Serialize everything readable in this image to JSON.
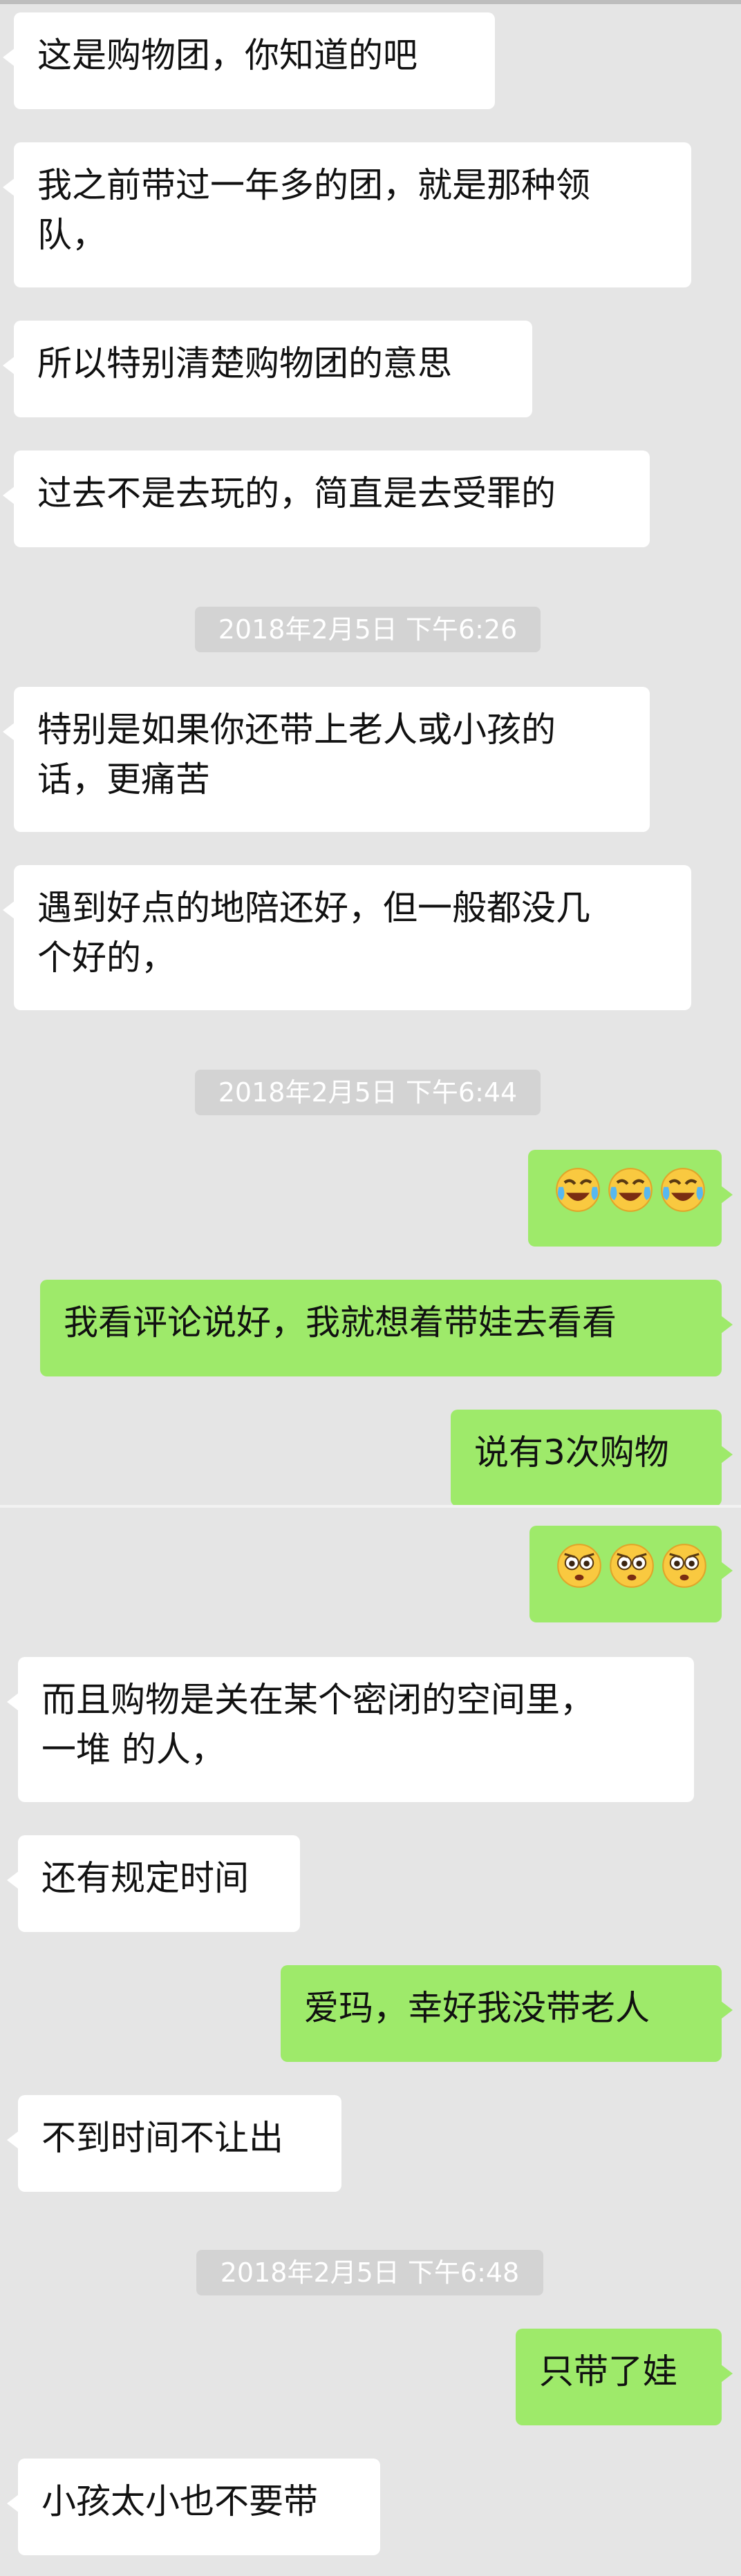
{
  "messages": [
    {
      "side": "in",
      "text": "这是购物团，你知道的吧"
    },
    {
      "side": "in",
      "text": "我之前带过一年多的团，就是那种领\n队，"
    },
    {
      "side": "in",
      "text": "所以特别清楚购物团的意思"
    },
    {
      "side": "in",
      "text": "过去不是去玩的，简直是去受罪的"
    },
    {
      "side": "in",
      "text": "特别是如果你还带上老人或小孩的\n话，更痛苦"
    },
    {
      "side": "in",
      "text": "遇到好点的地陪还好，但一般都没几\n个好的，"
    },
    {
      "side": "out",
      "emoji": "crying-laughing-face",
      "count": 3
    },
    {
      "side": "out",
      "text": "我看评论说好，我就想着带娃去看看"
    },
    {
      "side": "out",
      "text": "说有3次购物"
    },
    {
      "side": "out",
      "emoji": "wide-eyed-face",
      "count": 3
    },
    {
      "side": "in",
      "text": "而且购物是关在某个密闭的空间里，\n一堆 的人，"
    },
    {
      "side": "in",
      "text": "还有规定时间"
    },
    {
      "side": "out",
      "text": "爱玛，幸好我没带老人"
    },
    {
      "side": "in",
      "text": "不到时间不让出"
    },
    {
      "side": "out",
      "text": "只带了娃"
    },
    {
      "side": "in",
      "text": "小孩太小也不要带"
    }
  ],
  "timestamps": [
    "2018年2月5日 下午6:26",
    "2018年2月5日 下午6:44",
    "2018年2月5日 下午6:48"
  ],
  "colors": {
    "background": "#e5e5e5",
    "incoming_bubble": "#ffffff",
    "outgoing_bubble": "#9eea6a",
    "timestamp_badge": "#d3d3d3"
  }
}
